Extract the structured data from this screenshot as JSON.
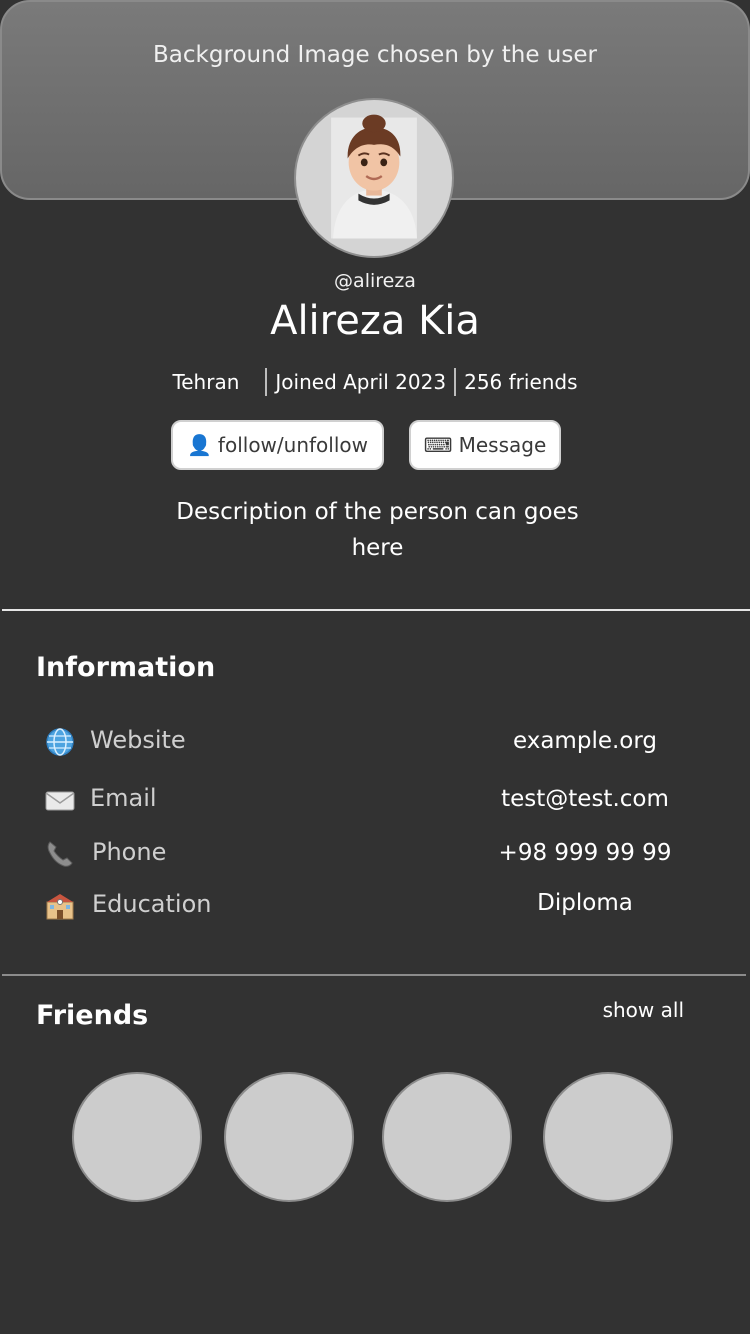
{
  "cover": {
    "text": "Background Image chosen by the user"
  },
  "profile": {
    "handle": "@alireza",
    "name": "Alireza Kia",
    "city": "Tehran",
    "joined": "Joined April 2023",
    "friends_count": "256 friends",
    "description": "Description of the person can goes here"
  },
  "actions": {
    "follow_icon": "👤",
    "follow_label": "follow/unfollow",
    "message_icon": "⌨",
    "message_label": "Message"
  },
  "information": {
    "title": "Information",
    "rows": [
      {
        "icon": "globe-icon",
        "glyph": "🌐",
        "label": "Website",
        "value": "example.org"
      },
      {
        "icon": "envelope-icon",
        "glyph": "✉",
        "label": "Email",
        "value": "test@test.com"
      },
      {
        "icon": "phone-icon",
        "glyph": "📞",
        "label": "Phone",
        "value": "+98 999 99 99"
      },
      {
        "icon": "school-icon",
        "glyph": "🏫",
        "label": "Education",
        "value": "Diploma"
      }
    ]
  },
  "friends": {
    "title": "Friends",
    "show_all": "show all"
  },
  "colors": {
    "background": "#323232",
    "cover": "#6e6e6e",
    "friend_placeholder": "#cccccc"
  }
}
